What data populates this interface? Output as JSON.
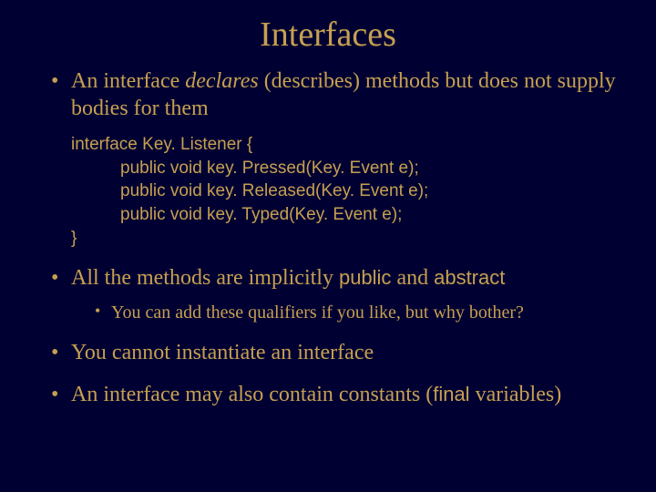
{
  "title": "Interfaces",
  "bullets": {
    "b1a": "An interface ",
    "b1b": "declares",
    "b1c": " (describes) methods but does not supply bodies for them",
    "b2a": "All the methods are implicitly ",
    "b2_public": "public",
    "b2_and": " and ",
    "b2_abstract": "abstract",
    "b2_sub": "You can add these qualifiers if you like, but why bother?",
    "b3": "You cannot instantiate an interface",
    "b4a": "An interface may also contain constants (",
    "b4_final": "final",
    "b4b": " variables)"
  },
  "code": {
    "l1": "interface Key. Listener {",
    "l2": "public void key. Pressed(Key. Event e);",
    "l3": "public void key. Released(Key. Event e);",
    "l4": "public void key. Typed(Key. Event e);",
    "l5": "}"
  }
}
